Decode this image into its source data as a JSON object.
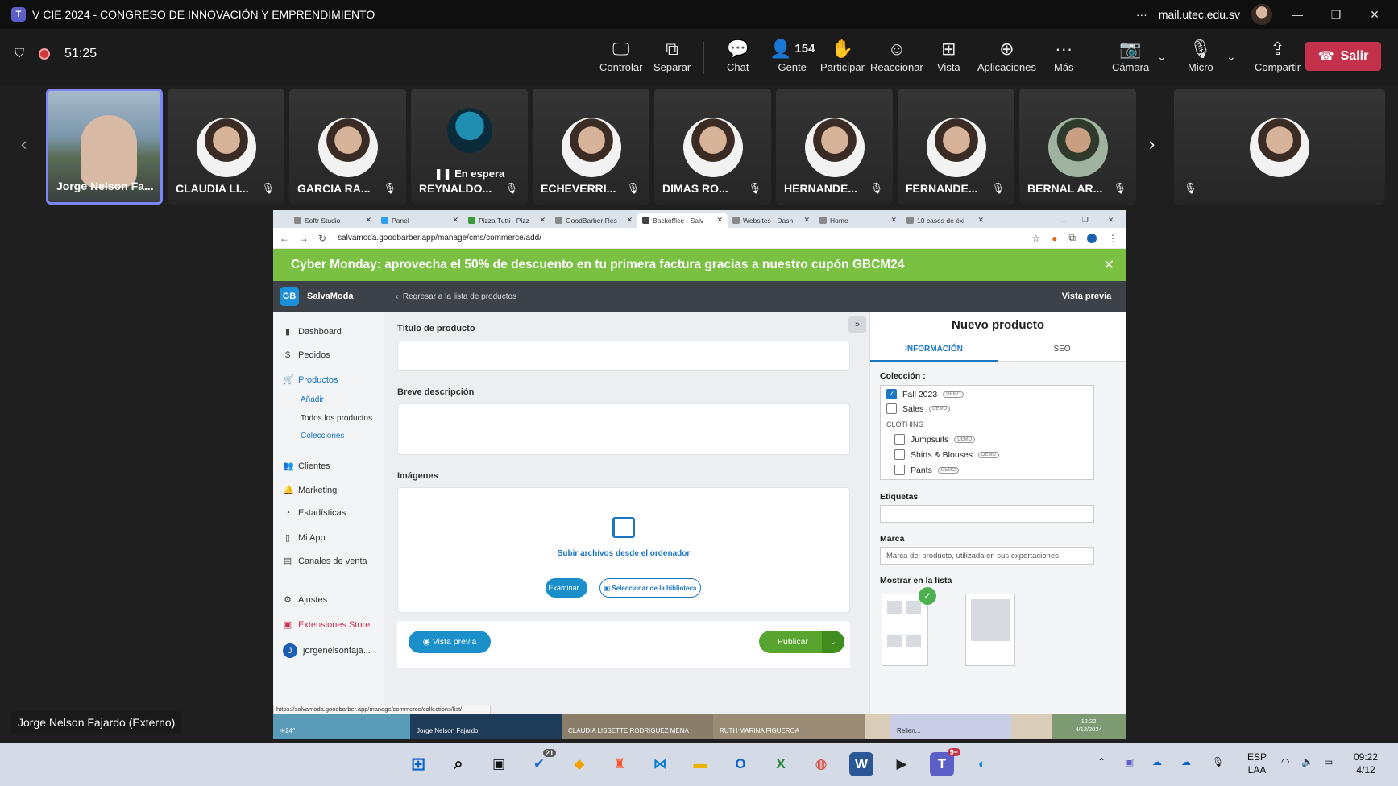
{
  "teams": {
    "window_title": "V CIE 2024 - CONGRESO DE INNOVACIÓN Y EMPRENDIMIENTO",
    "account": "mail.utec.edu.sv",
    "timer": "51:25",
    "buttons": {
      "control": "Controlar",
      "separate": "Separar",
      "chat": "Chat",
      "people": "Gente",
      "people_count": "154",
      "raise": "Participar",
      "react": "Reaccionar",
      "view": "Vista",
      "apps": "Aplicaciones",
      "more": "Más",
      "camera": "Cámara",
      "mic": "Micro",
      "share": "Compartir",
      "leave": "Salir"
    },
    "participants": [
      {
        "name": "Jorge Nelson Fa..."
      },
      {
        "name": "CLAUDIA LI..."
      },
      {
        "name": "GARCIA RA..."
      },
      {
        "name": "REYNALDO...",
        "status": "En espera"
      },
      {
        "name": "ECHEVERRI..."
      },
      {
        "name": "DIMAS RO..."
      },
      {
        "name": "HERNANDE..."
      },
      {
        "name": "FERNANDE..."
      },
      {
        "name": "BERNAL AR..."
      }
    ],
    "presenter_label": "Jorge Nelson Fajardo (Externo)"
  },
  "browser": {
    "tabs": [
      "Softr Studio",
      "Panel",
      "Pizza Tutti - Pizz",
      "GoodBarber Res",
      "Backoffice - Salv",
      "Websites - Dash",
      "Home",
      "10 casos de éxi"
    ],
    "url": "salvamoda.goodbarber.app/manage/cms/commerce/add/",
    "promo_text": "Cyber Monday: aprovecha el 50% de descuento en tu primera factura gracias a nuestro cupón GBCM24",
    "status_link": "https://salvamoda.goodbarber.app/manage/commerce/collections/list/"
  },
  "app": {
    "name": "SalvaModa",
    "back_link": "Regresar a la lista de productos",
    "preview_header": "Vista previa",
    "sidebar": {
      "dashboard": "Dashboard",
      "orders": "Pedidos",
      "products": "Productos",
      "add": "Añadir",
      "all_products": "Todos los productos",
      "collections": "Colecciones",
      "clients": "Clientes",
      "marketing": "Marketing",
      "stats": "Estadísticas",
      "my_app": "Mi App",
      "sales_channels": "Canales de venta",
      "settings": "Ajustes",
      "extensions": "Extensiones Store",
      "user": "jorgenelsonfaja..."
    },
    "form": {
      "title_label": "Título de producto",
      "desc_label": "Breve descripción",
      "images_label": "Imágenes",
      "upload_text": "Subir archivos desde el ordenador",
      "browse": "Examinar...",
      "library": "Seleccionar de la biblioteca",
      "preview_btn": "Vista previa",
      "publish": "Publicar"
    },
    "panel": {
      "heading": "Nuevo producto",
      "tab_info": "INFORMACIÓN",
      "tab_seo": "SEO",
      "collection_label": "Colección :",
      "collections": [
        {
          "name": "Fall 2023",
          "checked": true
        },
        {
          "name": "Sales",
          "checked": false
        }
      ],
      "group": "CLOTHING",
      "clothing": [
        {
          "name": "Jumpsuits",
          "checked": false
        },
        {
          "name": "Shirts & Blouses",
          "checked": false
        },
        {
          "name": "Pants",
          "checked": false
        }
      ],
      "demo_badge": "DEMO",
      "tags_label": "Etiquetas",
      "brand_label": "Marca",
      "brand_placeholder": "Marca del producto, utilizada en sus exportaciones",
      "show_in_list": "Mostrar en la lista"
    },
    "share_strip": {
      "temp": "24°",
      "name1": "Jorge Nelson Fajardo",
      "name2": "CLAUDIA LISSETTE RODRIGUEZ MENA",
      "name3": "RUTH MARINA FIGUEROA",
      "tile_text": "Rellen...",
      "clock": "12:22",
      "date": "4/12/2024"
    }
  },
  "taskbar": {
    "badge_todo": "21",
    "badge_teams": "9+",
    "lang": "ESP",
    "lang2": "LAA",
    "time": "09:22",
    "date": "4/12"
  }
}
